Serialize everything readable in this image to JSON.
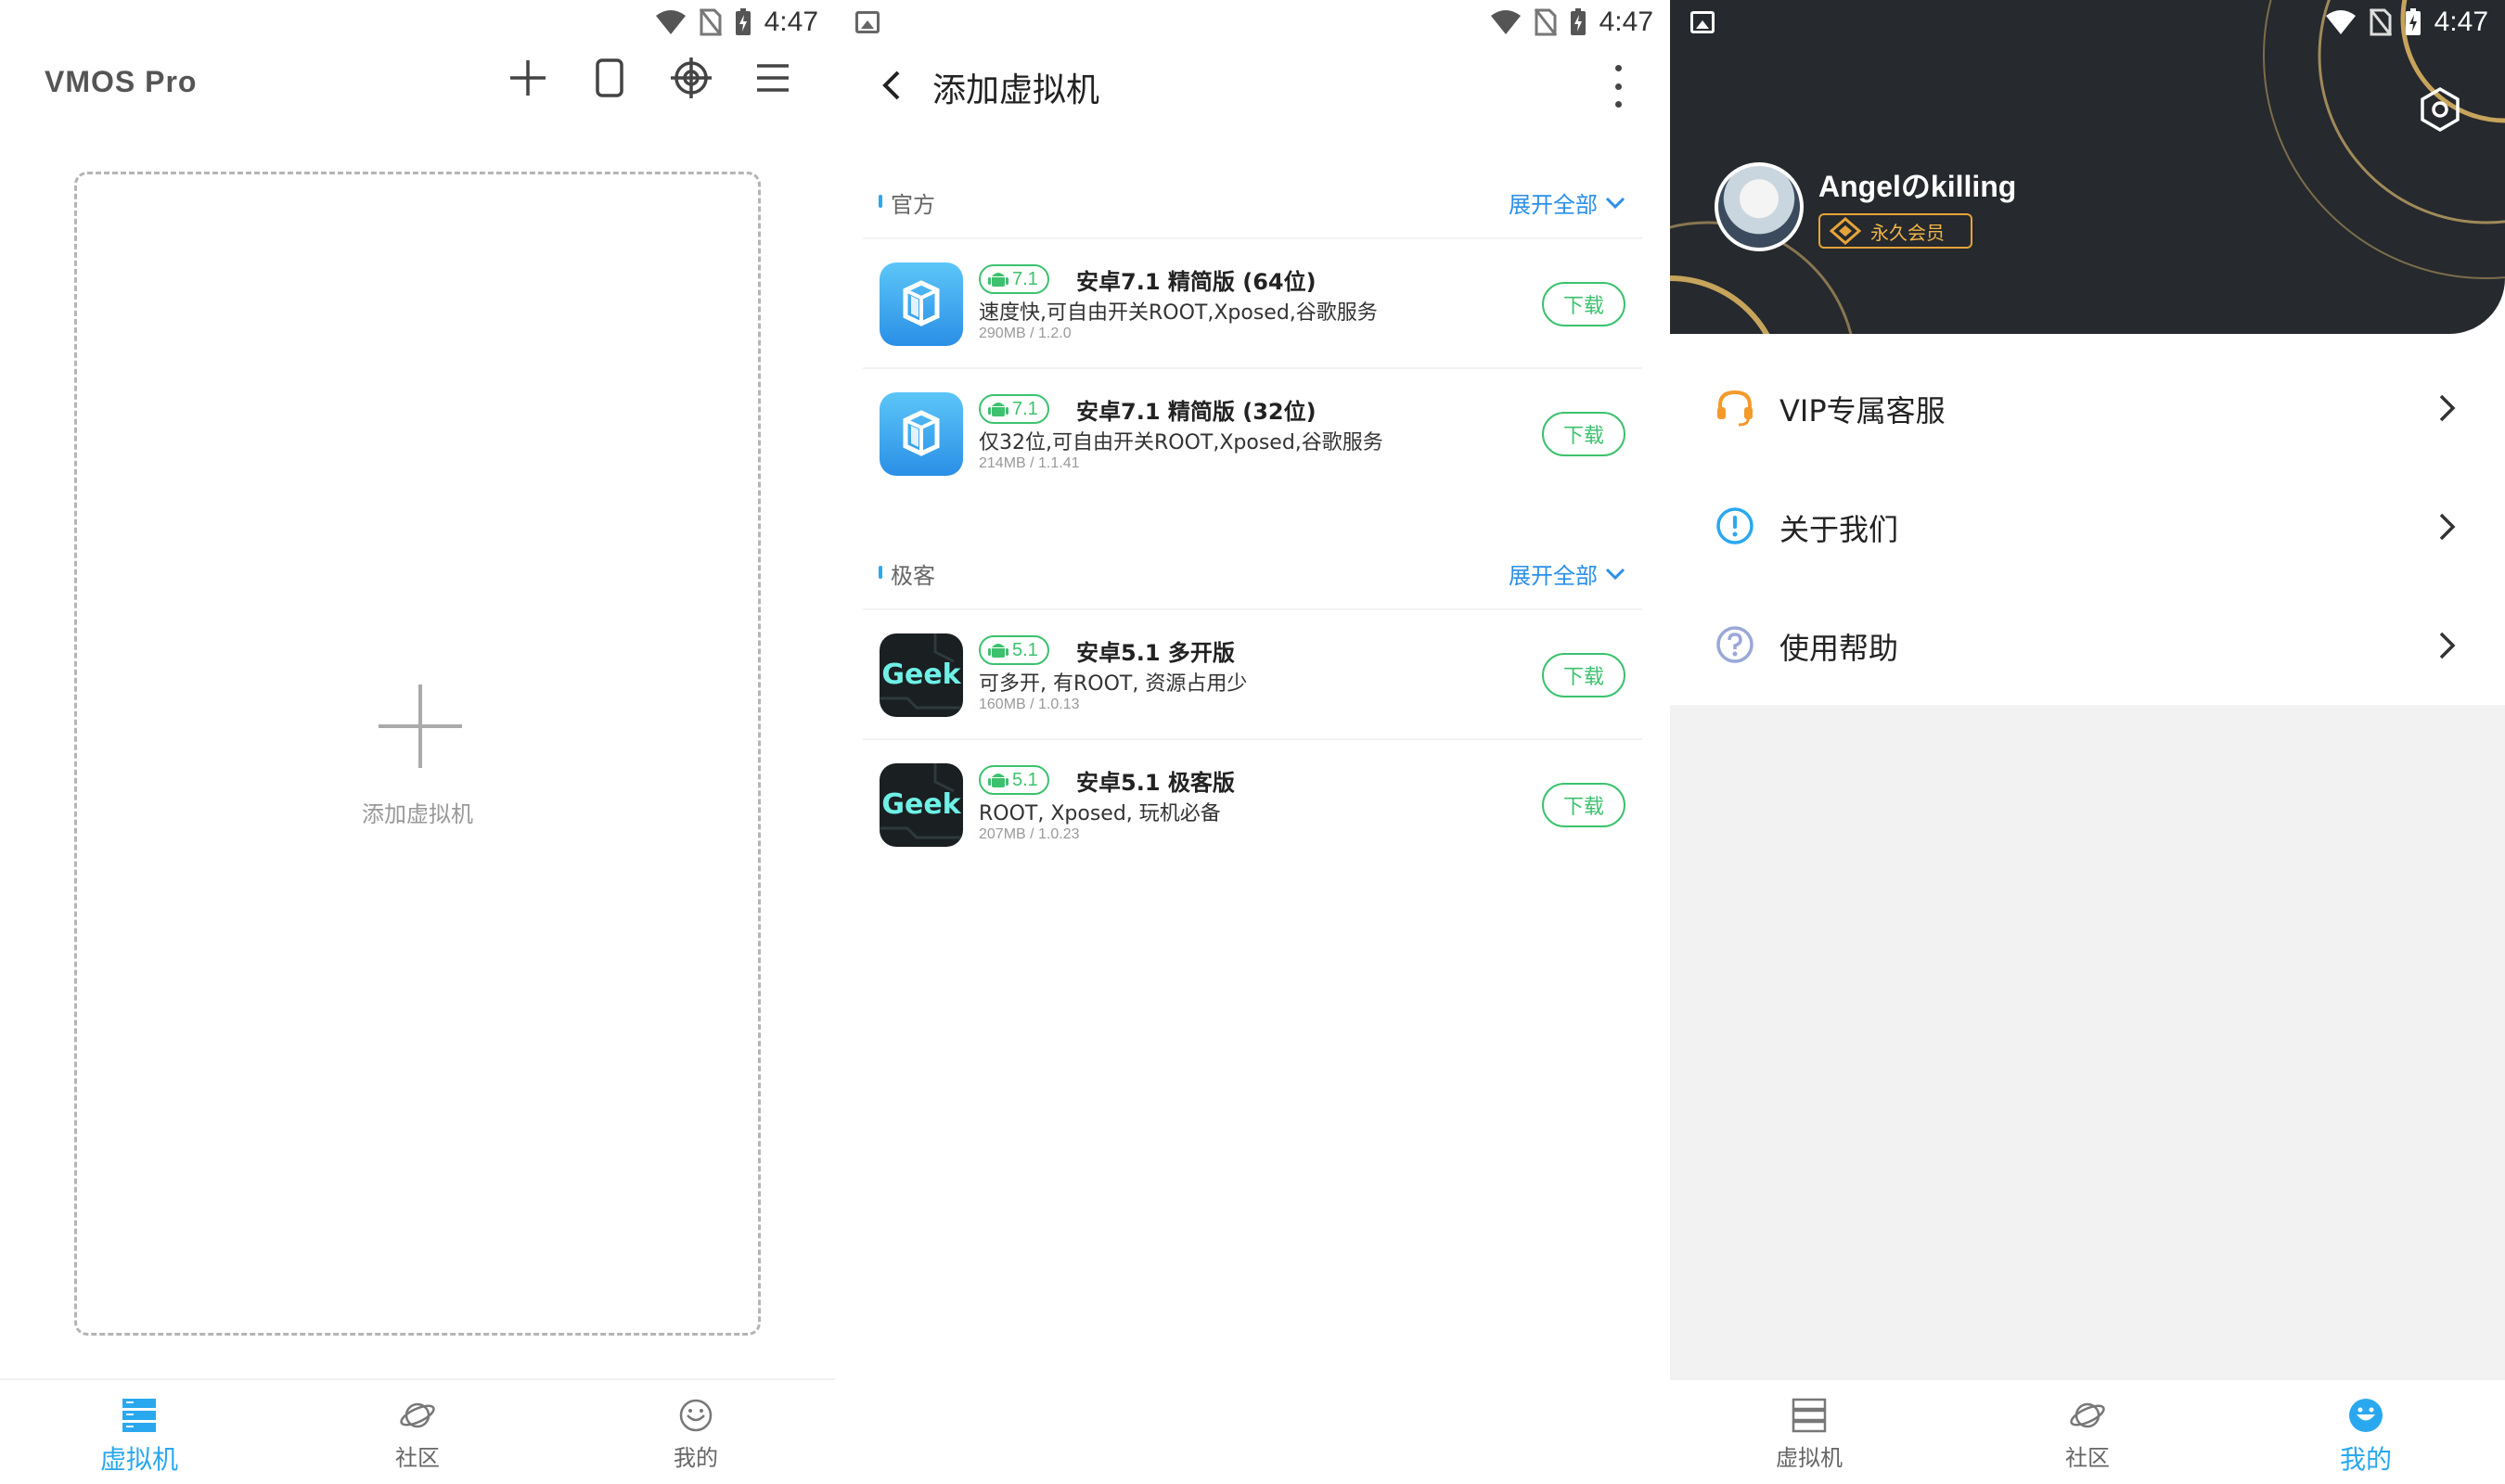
{
  "status": {
    "time": "4:47"
  },
  "screen1": {
    "app_title": "VMOS Pro",
    "toolbar_icons": [
      "plus-icon",
      "phone-frame-icon",
      "crosshair-icon",
      "menu-icon"
    ],
    "add_vm_label": "添加虚拟机"
  },
  "screen2": {
    "title": "添加虚拟机",
    "sections": [
      {
        "title": "官方",
        "expand": "展开全部",
        "items": [
          {
            "version": "7.1",
            "name": "安卓7.1 精简版 (64位)",
            "desc": "速度快,可自由开关ROOT,Xposed,谷歌服务",
            "meta": "290MB / 1.2.0",
            "button": "下载",
            "icon": "vmos-cube-icon"
          },
          {
            "version": "7.1",
            "name": "安卓7.1 精简版 (32位)",
            "desc": "仅32位,可自由开关ROOT,Xposed,谷歌服务",
            "meta": "214MB / 1.1.41",
            "button": "下载",
            "icon": "vmos-cube-icon"
          }
        ]
      },
      {
        "title": "极客",
        "expand": "展开全部",
        "items": [
          {
            "version": "5.1",
            "name": "安卓5.1 多开版",
            "desc": "可多开, 有ROOT, 资源占用少",
            "meta": "160MB / 1.0.13",
            "button": "下载",
            "icon": "geek-icon",
            "icon_text": "Geek"
          },
          {
            "version": "5.1",
            "name": "安卓5.1 极客版",
            "desc": "ROOT, Xposed, 玩机必备",
            "meta": "207MB / 1.0.23",
            "button": "下载",
            "icon": "geek-icon",
            "icon_text": "Geek"
          }
        ]
      }
    ]
  },
  "screen3": {
    "username": "Angelのkilling",
    "badge": "永久会员",
    "menu": [
      {
        "label": "VIP专属客服",
        "icon": "headset-icon"
      },
      {
        "label": "关于我们",
        "icon": "info-icon"
      },
      {
        "label": "使用帮助",
        "icon": "help-icon"
      }
    ]
  },
  "nav": {
    "items": [
      "虚拟机",
      "社区",
      "我的"
    ]
  },
  "colors": {
    "accent_blue": "#2aa8ef",
    "download_green": "#3cc26e",
    "profile_dark": "#26292d",
    "vip_gold": "#e5a43a"
  }
}
